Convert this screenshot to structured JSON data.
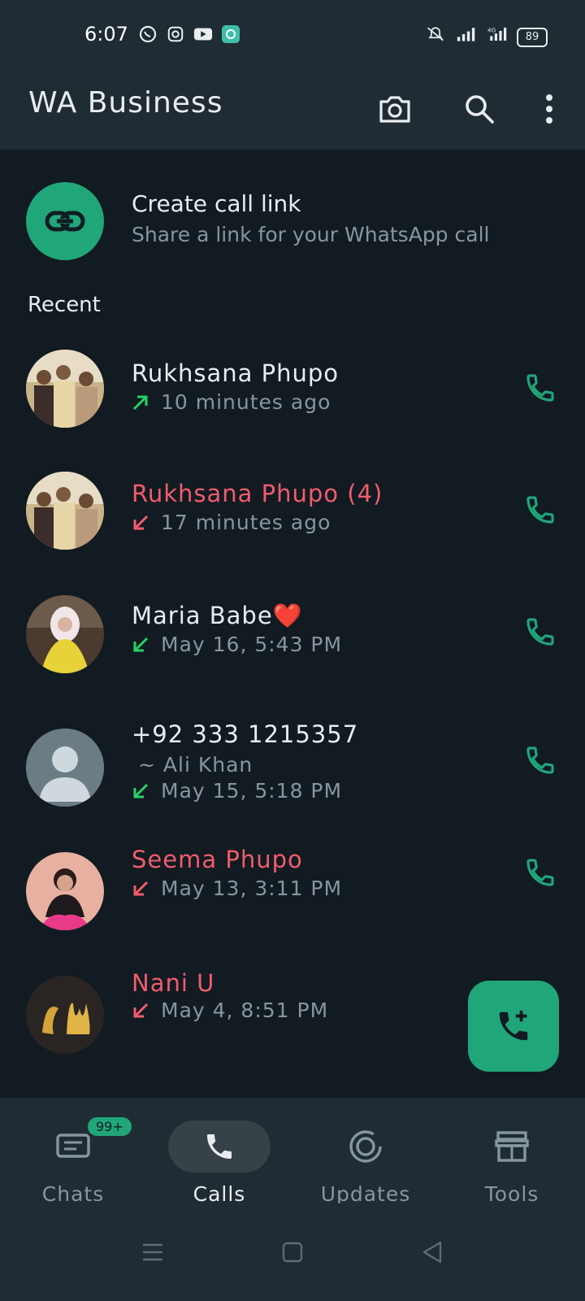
{
  "status": {
    "time": "6:07",
    "battery": "89",
    "network": "4G"
  },
  "app": {
    "title": "WA Business"
  },
  "call_link": {
    "title": "Create call link",
    "subtitle": "Share a link for your WhatsApp call"
  },
  "section": {
    "recent": "Recent"
  },
  "calls": [
    {
      "name": "Rukhsana Phupo",
      "detail": "",
      "time": "10 minutes ago",
      "direction": "outgoing",
      "missed": false
    },
    {
      "name": "Rukhsana Phupo (4)",
      "detail": "",
      "time": "17 minutes ago",
      "direction": "incoming",
      "missed": true
    },
    {
      "name": "Maria Babe❤️",
      "detail": "",
      "time": "May 16, 5:43 PM",
      "direction": "incoming",
      "missed": false
    },
    {
      "name": "+92 333 1215357",
      "detail": "~ Ali Khan",
      "time": "May 15, 5:18 PM",
      "direction": "incoming",
      "missed": false
    },
    {
      "name": "Seema Phupo",
      "detail": "",
      "time": "May 13, 3:11 PM",
      "direction": "incoming",
      "missed": true
    },
    {
      "name": "Nani U",
      "detail": "",
      "time": "May 4, 8:51 PM",
      "direction": "incoming",
      "missed": true
    }
  ],
  "nav": {
    "chats": "Chats",
    "chats_badge": "99+",
    "calls": "Calls",
    "updates": "Updates",
    "tools": "Tools"
  },
  "colors": {
    "accent": "#21a67a",
    "missed": "#f15c6d",
    "background": "#111b21",
    "bar": "#1f2c34"
  }
}
